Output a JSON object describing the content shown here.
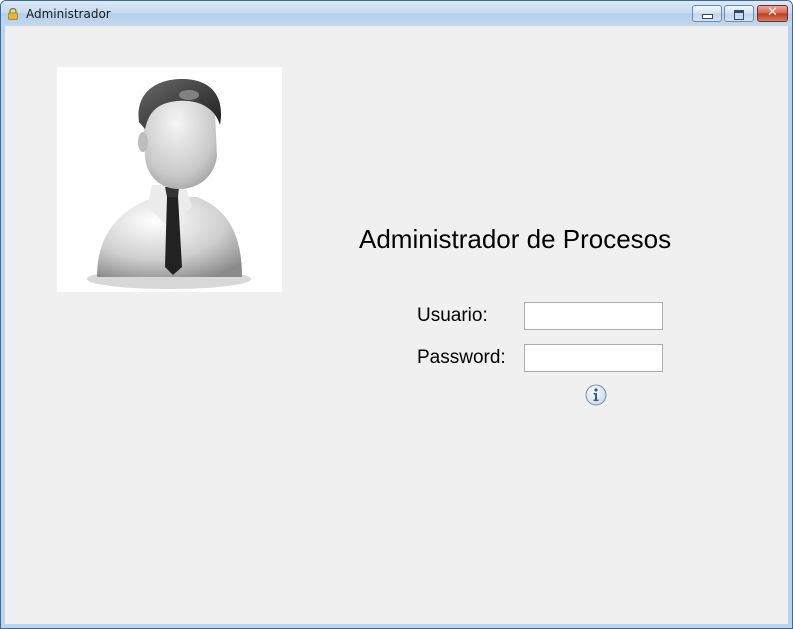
{
  "window": {
    "title": "Administrador",
    "icon": "lock-icon",
    "controls": {
      "minimize_icon": "minimize-icon",
      "maximize_icon": "maximize-icon",
      "close_glyph": "✕"
    }
  },
  "main": {
    "avatar_icon": "user-avatar-icon",
    "heading": "Administrador de Procesos",
    "username": {
      "label": "Usuario:",
      "value": ""
    },
    "password": {
      "label": "Password:",
      "value": ""
    },
    "info_icon": "info-icon"
  },
  "colors": {
    "client_background": "#f0f0f0",
    "titlebar": "#c4d9ef",
    "close_button": "#c94a2e"
  }
}
